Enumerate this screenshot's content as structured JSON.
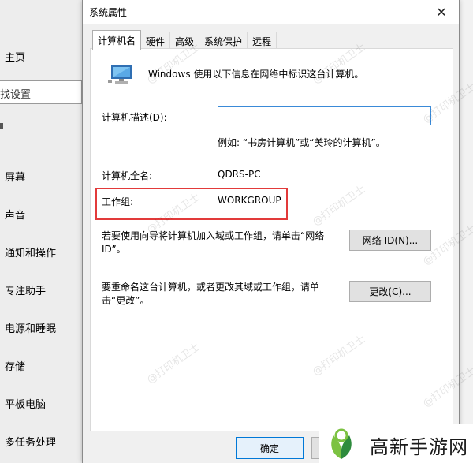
{
  "settings": {
    "home": "主页",
    "search_placeholder": "找设置",
    "nav_items": [
      "屏幕",
      "声音",
      "通知和操作",
      "专注助手",
      "电源和睡眠",
      "存储",
      "平板电脑",
      "多任务处理"
    ]
  },
  "dialog": {
    "title": "系统属性",
    "close_glyph": "✕",
    "tabs": [
      "计算机名",
      "硬件",
      "高级",
      "系统保护",
      "远程"
    ],
    "intro": "Windows 使用以下信息在网络中标识这台计算机。",
    "description_label": "计算机描述(D):",
    "description_value": "",
    "example": "例如: “书房计算机”或“美玲的计算机”。",
    "full_name_label": "计算机全名:",
    "full_name_value": "QDRS-PC",
    "workgroup_label": "工作组:",
    "workgroup_value": "WORKGROUP",
    "network_id_text": "若要使用向导将计算机加入域或工作组，请单击“网络 ID”。",
    "network_id_button": "网络 ID(N)...",
    "rename_text": "要重命名这台计算机，或者更改其域或工作组，请单击“更改”。",
    "change_button": "更改(C)...",
    "ok_button": "确定"
  },
  "watermark": "@打印机卫士",
  "brand": {
    "name": "高新手游网",
    "colors": {
      "green": "#7cc242",
      "dark_green": "#2e8b3d"
    }
  },
  "colors": {
    "highlight_border": "#e23a3a",
    "input_border": "#3a8ad8"
  }
}
